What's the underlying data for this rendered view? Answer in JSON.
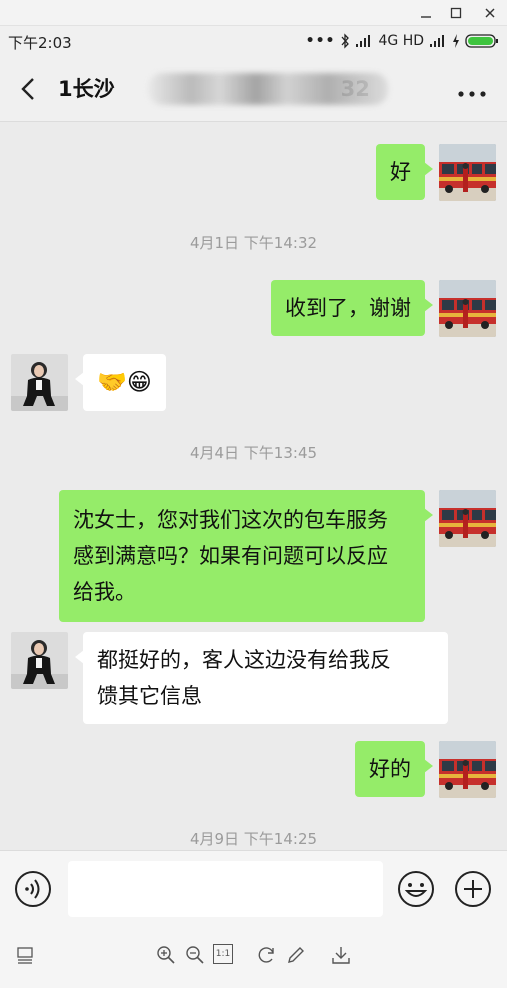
{
  "status_bar": {
    "time": "下午2:03",
    "network": "4G HD"
  },
  "header": {
    "title_visible": "1长沙",
    "title_suffix": "32"
  },
  "messages": [
    {
      "type": "text",
      "from": "me",
      "text": "好"
    },
    {
      "type": "time",
      "text": "4月1日 下午14:32"
    },
    {
      "type": "text",
      "from": "me",
      "text": "收到了，谢谢"
    },
    {
      "type": "emoji",
      "from": "other",
      "text": "🤝😁"
    },
    {
      "type": "time",
      "text": "4月4日 下午13:45"
    },
    {
      "type": "text",
      "from": "me",
      "lines": [
        "沈女士，您对我们这次的包车服务",
        "感到满意吗？如果有问题可以反应",
        "给我。"
      ]
    },
    {
      "type": "text",
      "from": "other",
      "lines": [
        "都挺好的，客人这边没有给我反",
        "馈其它信息"
      ]
    },
    {
      "type": "text",
      "from": "me",
      "text": "好的"
    },
    {
      "type": "time",
      "text": "4月9日 下午14:25"
    }
  ],
  "input": {
    "value": ""
  },
  "icons": {
    "back": "back-arrow-icon",
    "more": "more-dots-icon",
    "voice": "voice-icon",
    "emoji": "emoji-icon",
    "add": "plus-icon"
  },
  "colors": {
    "my_bubble": "#95ec69",
    "other_bubble": "#ffffff",
    "chat_bg": "#ebebeb"
  },
  "toolbar": {
    "zoom_ratio": "1:1"
  }
}
